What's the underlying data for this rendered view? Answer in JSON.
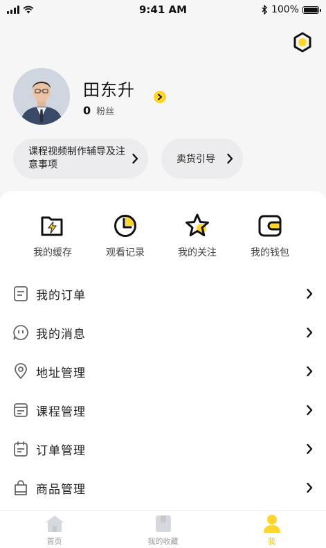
{
  "status_bar": {
    "time": "9:41 AM",
    "battery": "100%"
  },
  "profile": {
    "name": "田东升",
    "fans_count": "0",
    "fans_label": "粉丝"
  },
  "pills": [
    {
      "label": "课程视频制作辅导及注意事项"
    },
    {
      "label": "卖货引导"
    }
  ],
  "quick_actions": [
    {
      "label": "我的缓存",
      "icon": "folder-bolt-icon"
    },
    {
      "label": "观看记录",
      "icon": "clock-icon"
    },
    {
      "label": "我的关注",
      "icon": "star-icon"
    },
    {
      "label": "我的钱包",
      "icon": "wallet-icon"
    }
  ],
  "menu": [
    {
      "label": "我的订单",
      "icon": "order-list-icon"
    },
    {
      "label": "我的消息",
      "icon": "message-icon"
    },
    {
      "label": "地址管理",
      "icon": "location-pin-icon"
    },
    {
      "label": "课程管理",
      "icon": "course-icon"
    },
    {
      "label": "订单管理",
      "icon": "calendar-icon"
    },
    {
      "label": "商品管理",
      "icon": "shopping-bag-icon"
    }
  ],
  "tabbar": [
    {
      "label": "首页",
      "icon": "home-icon",
      "active": false
    },
    {
      "label": "我的收藏",
      "icon": "bookmark-icon",
      "active": false
    },
    {
      "label": "我",
      "icon": "profile-icon",
      "active": true
    }
  ],
  "colors": {
    "accent": "#ffd52e",
    "accent_text": "#f2c200",
    "pill_bg": "#ececee"
  }
}
